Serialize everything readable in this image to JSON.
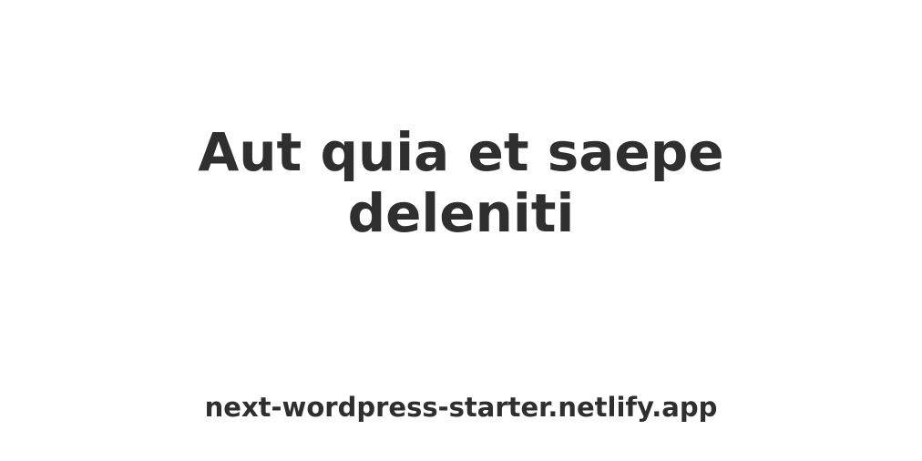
{
  "card": {
    "title_lines": [
      "Aut quia et saepe",
      "deleniti"
    ],
    "site_url": "next-wordpress-starter.netlify.app"
  },
  "colors": {
    "background": "#ffffff",
    "text": "#2f2f2f"
  }
}
